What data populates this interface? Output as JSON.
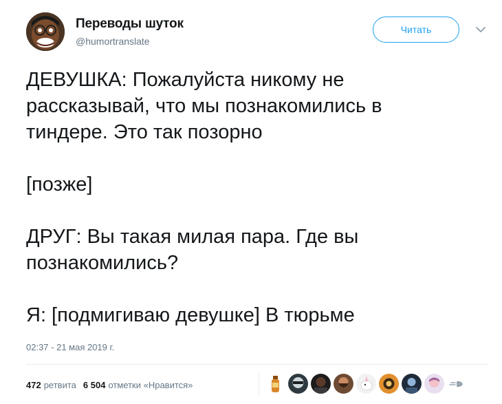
{
  "account": {
    "display_name": "Переводы шуток",
    "handle": "@humortranslate",
    "avatar_icon": "face-avatar-icon"
  },
  "actions": {
    "follow_label": "Читать",
    "menu_icon": "chevron-down-icon"
  },
  "tweet": {
    "lines": [
      "ДЕВУШКА: Пожалуйста никому не",
      "рассказывай, что мы познакомились в",
      "тиндере. Это так позорно",
      "",
      "[позже]",
      "",
      "ДРУГ: Вы такая милая пара. Где вы",
      "познакомились?",
      "",
      "Я: [подмигиваю девушке] В тюрьме"
    ],
    "timestamp": "02:37 - 21 мая 2019 г."
  },
  "stats": {
    "retweets_count": "472",
    "retweets_label": "ретвита",
    "likes_count": "6 504",
    "likes_label": "отметки «Нравится»"
  },
  "likers": {
    "avatars": [
      "bottle-avatar",
      "masked-avatar",
      "dark-avatar",
      "bearded-avatar",
      "unicorn-avatar",
      "orange-avatar",
      "blue-avatar",
      "pink-avatar"
    ],
    "more_icon": "more-likers-icon"
  },
  "colors": {
    "accent": "#1da1f2",
    "text": "#14171a",
    "secondary": "#657786",
    "divider": "#e6ecf0"
  }
}
